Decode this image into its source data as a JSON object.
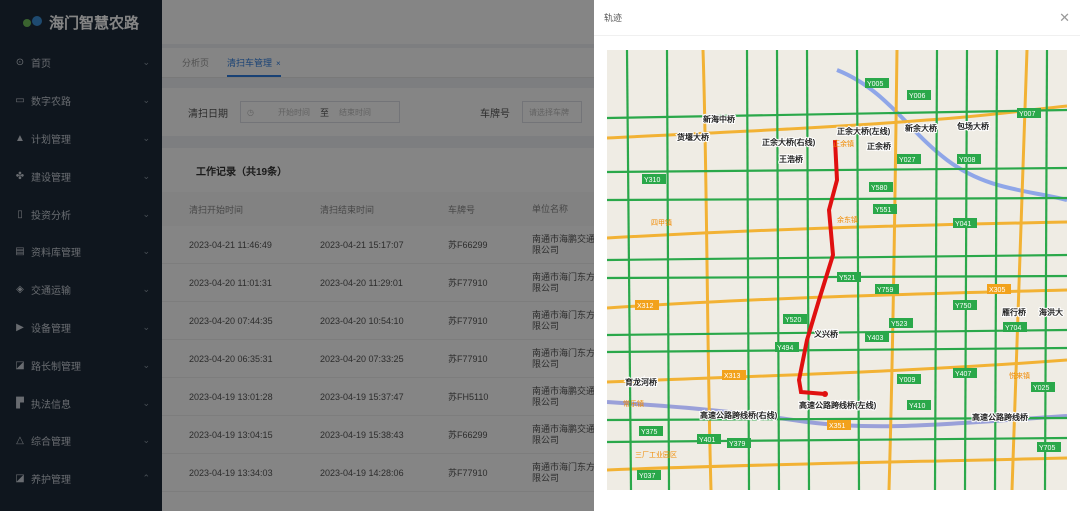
{
  "app": {
    "title": "海门智慧农路"
  },
  "sidebar": {
    "items": [
      {
        "label": "首页",
        "icon": "home-icon",
        "glyph": "⊙"
      },
      {
        "label": "数字农路",
        "icon": "monitor-icon",
        "glyph": "▭"
      },
      {
        "label": "计划管理",
        "icon": "calendar-icon",
        "glyph": "▲"
      },
      {
        "label": "建设管理",
        "icon": "tools-icon",
        "glyph": "✤"
      },
      {
        "label": "投资分析",
        "icon": "document-icon",
        "glyph": "▯"
      },
      {
        "label": "资料库管理",
        "icon": "book-icon",
        "glyph": "▤"
      },
      {
        "label": "交通运输",
        "icon": "car-icon",
        "glyph": "◈"
      },
      {
        "label": "设备管理",
        "icon": "device-icon",
        "glyph": "▶"
      },
      {
        "label": "路长制管理",
        "icon": "road-icon",
        "glyph": "◪"
      },
      {
        "label": "执法信息",
        "icon": "flag-icon",
        "glyph": "▛"
      },
      {
        "label": "综合管理",
        "icon": "building-icon",
        "glyph": "△"
      },
      {
        "label": "养护管理",
        "icon": "road-icon",
        "glyph": "◪"
      }
    ],
    "chevrons": [
      "⌄",
      "⌄",
      "⌄",
      "⌄",
      "⌄",
      "⌄",
      "⌄",
      "⌄",
      "⌄",
      "⌄",
      "⌄",
      "⌃"
    ]
  },
  "tabs": [
    {
      "label": "分析页"
    },
    {
      "label": "清扫车管理",
      "close": "×"
    }
  ],
  "filters": {
    "date_label": "清扫日期",
    "start_placeholder": "开始时间",
    "separator": "至",
    "end_placeholder": "结束时间",
    "plate_label": "车牌号",
    "plate_placeholder": "请选择车牌"
  },
  "records": {
    "title": "工作记录（共19条）",
    "columns": [
      "清扫开始时间",
      "清扫结束时间",
      "车牌号",
      "单位名称"
    ],
    "rows": [
      [
        "2023-04-21 11:46:49",
        "2023-04-21 15:17:07",
        "苏F66299",
        "南通市海鹏交通",
        "限公司"
      ],
      [
        "2023-04-20 11:01:31",
        "2023-04-20 11:29:01",
        "苏F77910",
        "南通市海门东方",
        "限公司"
      ],
      [
        "2023-04-20 07:44:35",
        "2023-04-20 10:54:10",
        "苏F77910",
        "南通市海门东方",
        "限公司"
      ],
      [
        "2023-04-20 06:35:31",
        "2023-04-20 07:33:25",
        "苏F77910",
        "南通市海门东方",
        "限公司"
      ],
      [
        "2023-04-19 13:01:28",
        "2023-04-19 15:37:47",
        "苏FH5110",
        "南通市海鹏交通",
        "限公司"
      ],
      [
        "2023-04-19 13:04:15",
        "2023-04-19 15:38:43",
        "苏F66299",
        "南通市海鹏交通",
        "限公司"
      ],
      [
        "2023-04-19 13:34:03",
        "2023-04-19 14:28:06",
        "苏F77910",
        "南通市海门东方",
        "限公司"
      ]
    ]
  },
  "drawer": {
    "title": "轨迹",
    "close": "✕",
    "map_labels": [
      "新海中桥",
      "货堰大桥",
      "正余大桥(右线)",
      "正余大桥(左线)",
      "新余大桥",
      "包场大桥",
      "王浩桥",
      "正余桥",
      "义兴桥",
      "雁行桥",
      "海洪大",
      "育龙河桥",
      "高速公路跨线桥(左线)",
      "高速公路跨线桥(右线)",
      "高速公路跨线桥"
    ],
    "town_labels": [
      "正余镇",
      "四甲镇",
      "余东镇",
      "悦来镇",
      "常乐镇",
      "三厂工业园区"
    ],
    "road_badges": [
      "Y005",
      "Y006",
      "Y007",
      "Y027",
      "Y008",
      "Y310",
      "Y580",
      "Y551",
      "Y041",
      "Y521",
      "Y759",
      "X305",
      "Y750",
      "X312",
      "Y520",
      "Y523",
      "Y704",
      "Y494",
      "Y403",
      "X313",
      "Y009",
      "Y407",
      "Y410",
      "Y025",
      "X351",
      "Y375",
      "Y401",
      "Y379",
      "Y705",
      "Y037"
    ]
  }
}
